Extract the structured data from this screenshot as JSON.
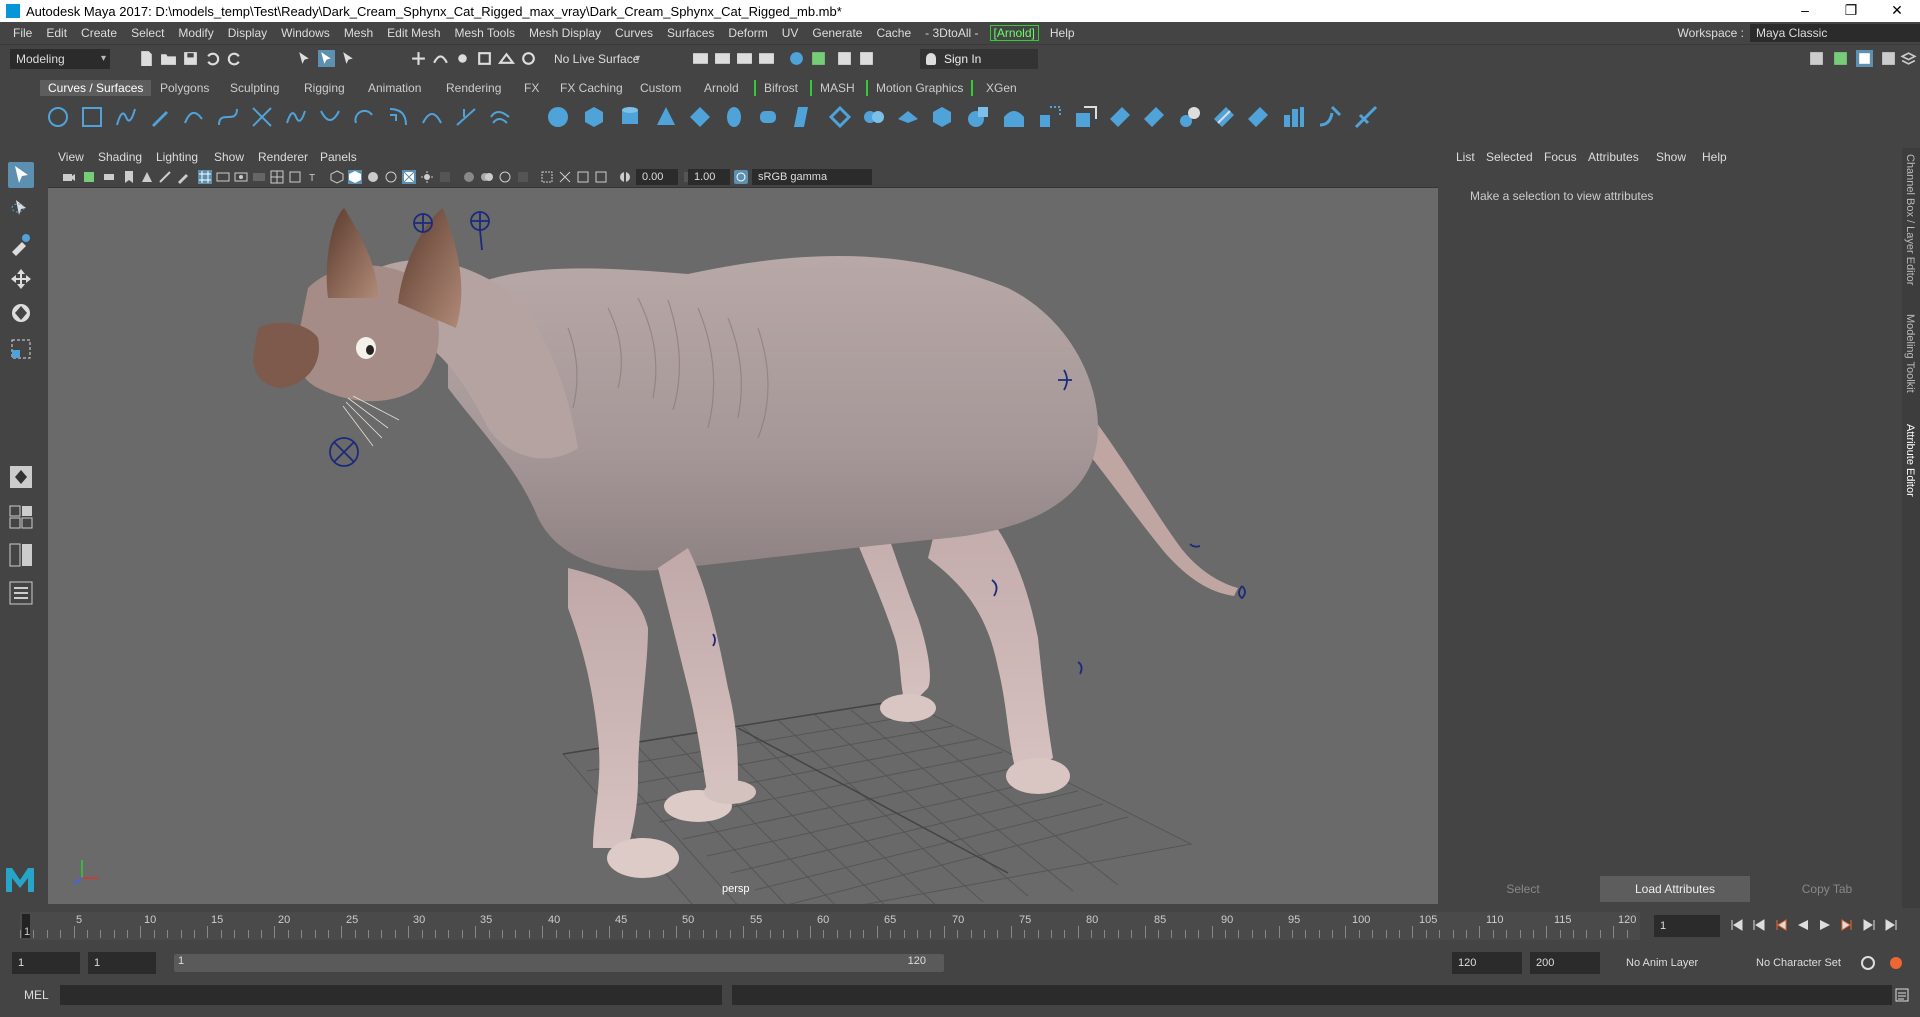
{
  "window": {
    "title": "Autodesk Maya 2017: D:\\models_temp\\Test\\Ready\\Dark_Cream_Sphynx_Cat_Rigged_max_vray\\Dark_Cream_Sphynx_Cat_Rigged_mb.mb*",
    "controls": [
      "–",
      "❐",
      "✕"
    ]
  },
  "menubar": {
    "items": [
      "File",
      "Edit",
      "Create",
      "Select",
      "Modify",
      "Display",
      "Windows",
      "Mesh",
      "Edit Mesh",
      "Mesh Tools",
      "Mesh Display",
      "Curves",
      "Surfaces",
      "Deform",
      "UV",
      "Generate",
      "Cache",
      "- 3DtoAll -",
      "[Arnold]",
      "Help"
    ],
    "workspace_label": "Workspace :",
    "workspace_value": "Maya Classic"
  },
  "statusline": {
    "mode": "Modeling",
    "live_surface": "No Live Surface",
    "sign_in": "Sign In"
  },
  "shelf": {
    "tabs": [
      "Curves / Surfaces",
      "Polygons",
      "Sculpting",
      "Rigging",
      "Animation",
      "Rendering",
      "FX",
      "FX Caching",
      "Custom",
      "Arnold",
      "Bifrost",
      "MASH",
      "Motion Graphics",
      "XGen"
    ],
    "active_tab": "Curves / Surfaces",
    "accent_color": "#4fa3d9"
  },
  "viewport": {
    "menus": [
      "View",
      "Shading",
      "Lighting",
      "Show",
      "Renderer",
      "Panels"
    ],
    "exposure": "0.00",
    "gamma": "1.00",
    "color_space": "sRGB gamma",
    "camera": "persp",
    "background_color": "#6a6a6a"
  },
  "attribute_editor": {
    "menus": [
      "List",
      "Selected",
      "Focus",
      "Attributes",
      "Show",
      "Help"
    ],
    "message": "Make a selection to view attributes",
    "buttons": [
      "Select",
      "Load Attributes",
      "Copy Tab"
    ],
    "side_tabs": [
      "Channel Box / Layer Editor",
      "Modeling Toolkit",
      "Attribute Editor"
    ]
  },
  "timeslider": {
    "labels": [
      "1",
      "5",
      "10",
      "15",
      "20",
      "25",
      "30",
      "35",
      "40",
      "45",
      "50",
      "55",
      "60",
      "65",
      "70",
      "75",
      "80",
      "85",
      "90",
      "95",
      "100",
      "105",
      "110",
      "115",
      "120"
    ],
    "current_frame": "1"
  },
  "rangeslider": {
    "start": "1",
    "anim_start": "1",
    "range_start": "1",
    "range_end": "120",
    "end": "120",
    "anim_end": "200",
    "anim_layer": "No Anim Layer",
    "character_set": "No Character Set"
  },
  "cmdline": {
    "label": "MEL"
  }
}
